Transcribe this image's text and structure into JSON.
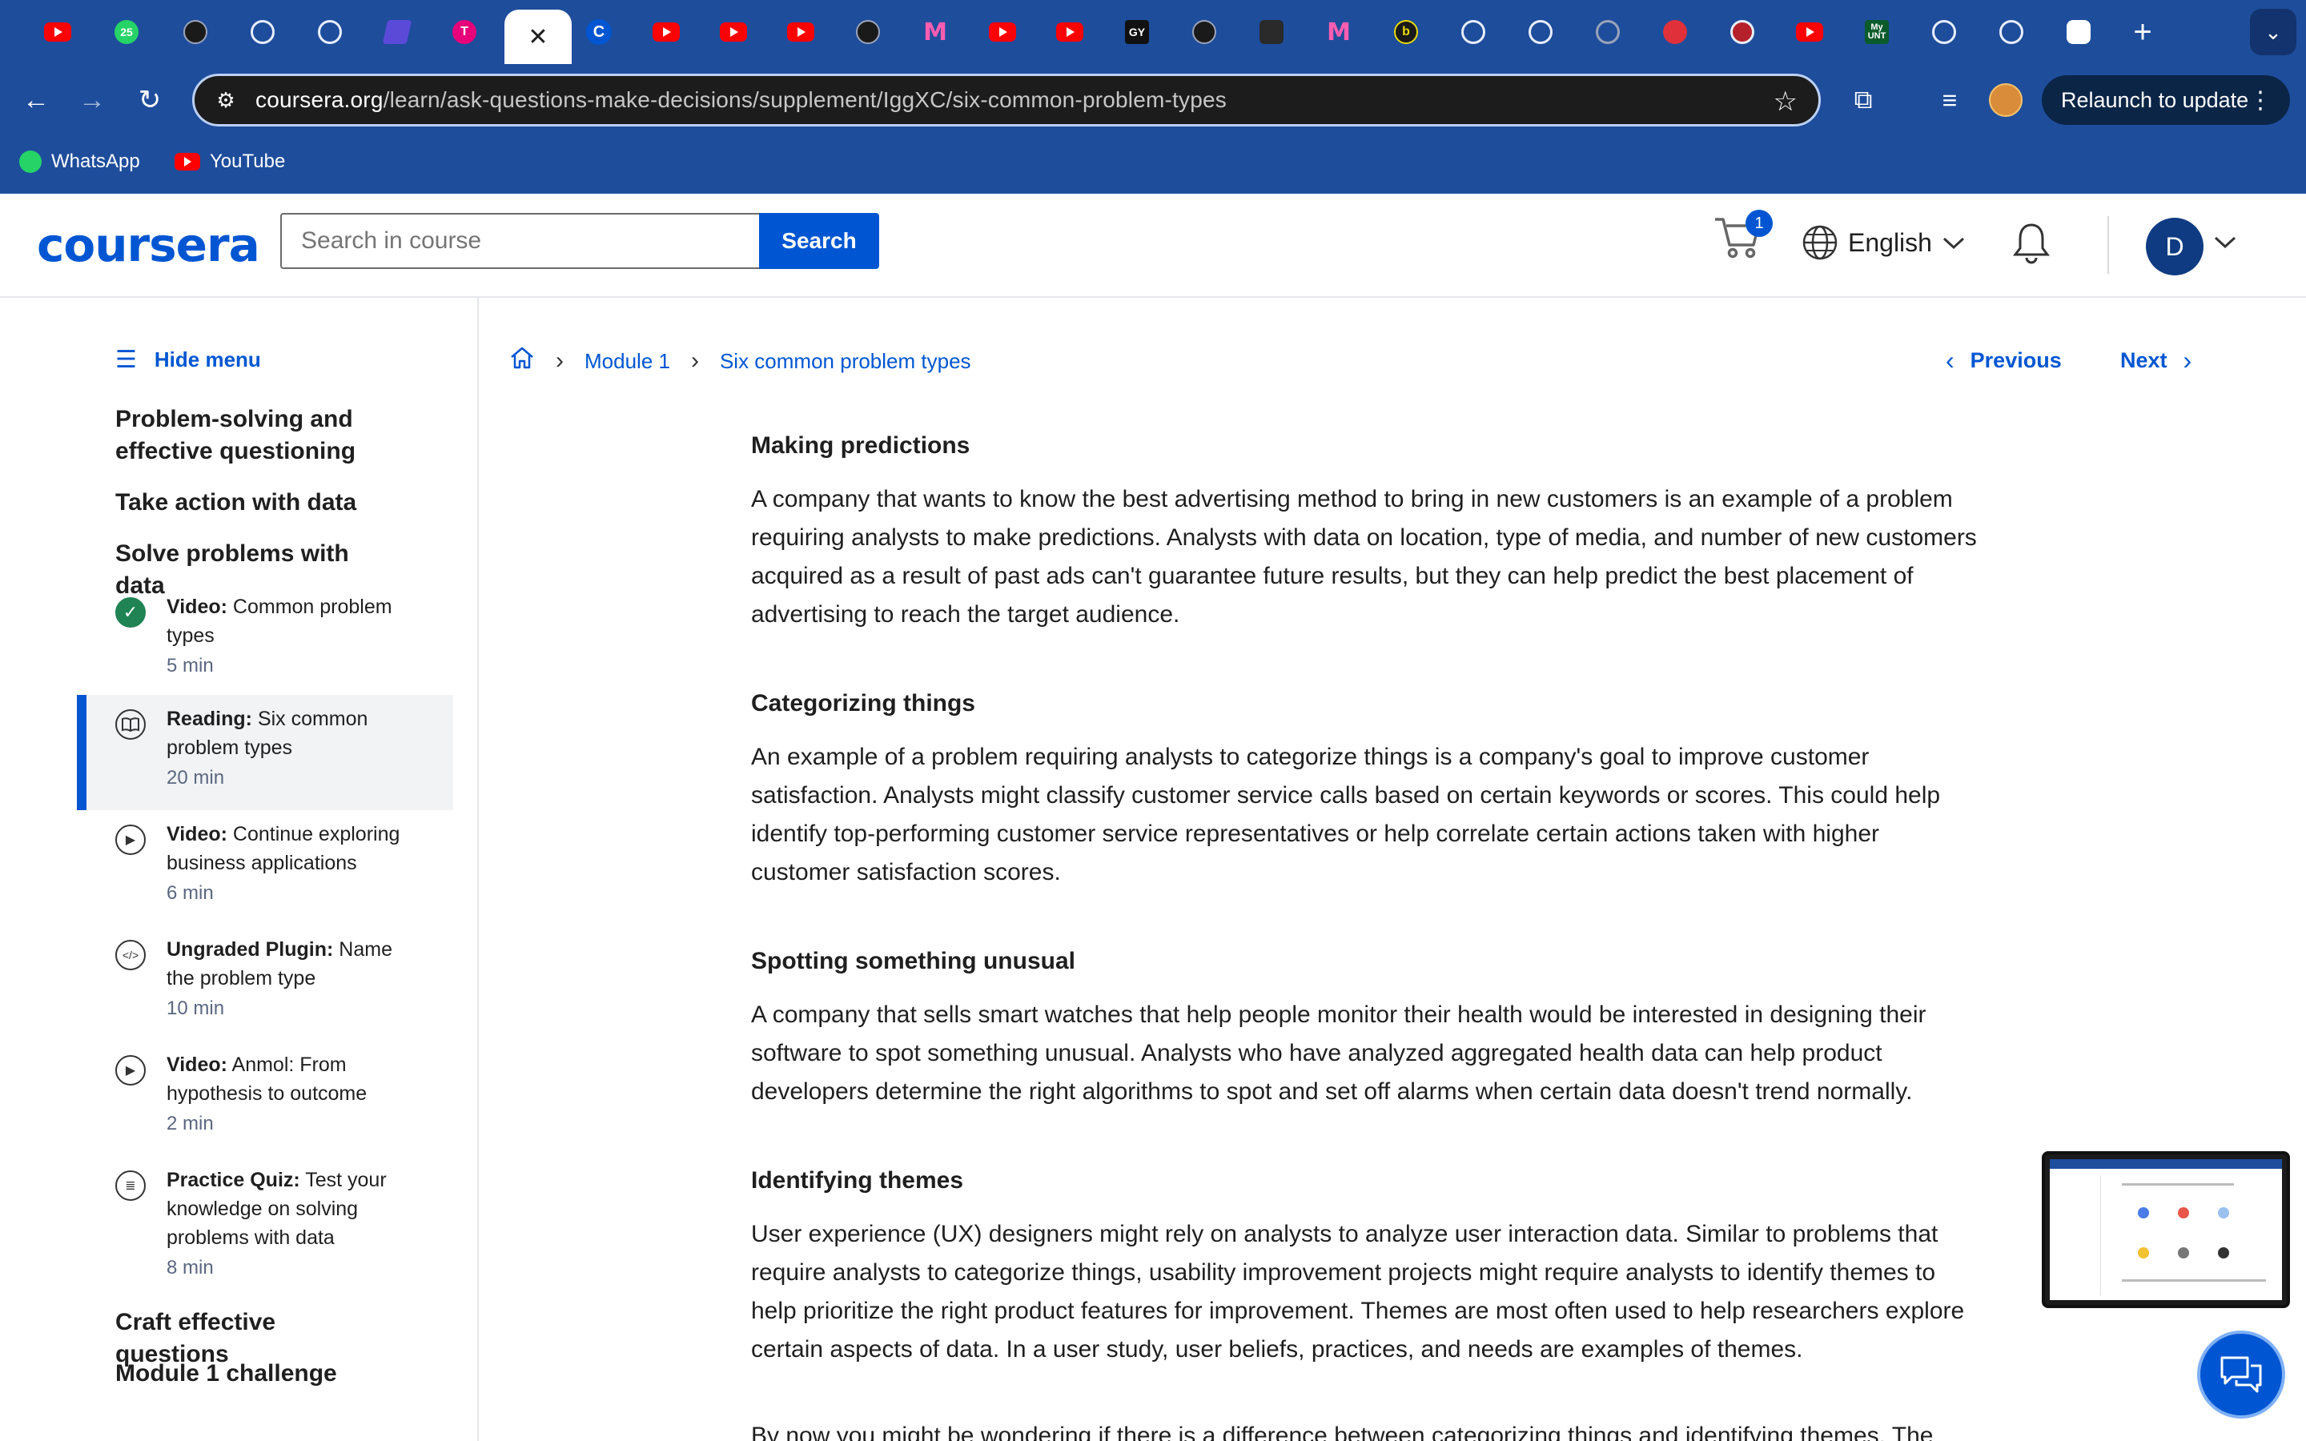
{
  "browser": {
    "tabs": [
      {
        "icon": "youtube-icon"
      },
      {
        "icon": "whatsapp-icon",
        "badge": "25"
      },
      {
        "icon": "openai-icon"
      },
      {
        "icon": "circle-icon"
      },
      {
        "icon": "github-icon"
      },
      {
        "icon": "app-icon"
      },
      {
        "icon": "t-icon"
      },
      {
        "icon": "close-icon",
        "active": true
      },
      {
        "icon": "coursera-icon"
      },
      {
        "icon": "youtube-icon"
      },
      {
        "icon": "youtube-icon"
      },
      {
        "icon": "youtube-icon"
      },
      {
        "icon": "compass-icon"
      },
      {
        "icon": "m-icon"
      },
      {
        "icon": "youtube-icon"
      },
      {
        "icon": "youtube-icon"
      },
      {
        "icon": "gy-icon"
      },
      {
        "icon": "openai-icon"
      },
      {
        "icon": "video-icon"
      },
      {
        "icon": "m-icon"
      },
      {
        "icon": "b-icon"
      },
      {
        "icon": "target-icon"
      },
      {
        "icon": "target-icon"
      },
      {
        "icon": "ring-icon"
      },
      {
        "icon": "red-ball-icon"
      },
      {
        "icon": "red-ball-icon"
      },
      {
        "icon": "youtube-icon"
      },
      {
        "icon": "unt-icon",
        "label": "My UNT"
      },
      {
        "icon": "coursera-icon"
      },
      {
        "icon": "coursera-icon"
      },
      {
        "icon": "openai-icon"
      }
    ],
    "url_domain": "coursera.org",
    "url_path": "/learn/ask-questions-make-decisions/supplement/IggXC/six-common-problem-types",
    "relaunch_label": "Relaunch to update",
    "bookmarks": [
      {
        "label": "WhatsApp",
        "icon": "whatsapp-icon"
      },
      {
        "label": "YouTube",
        "icon": "youtube-icon"
      }
    ]
  },
  "header": {
    "logo": "coursera",
    "search_placeholder": "Search in course",
    "search_button": "Search",
    "cart_count": "1",
    "language": "English",
    "avatar_initial": "D"
  },
  "sidebar": {
    "hide_menu": "Hide menu",
    "sections": [
      "Problem-solving and effective questioning",
      "Take action with data",
      "Solve problems with data"
    ],
    "items": [
      {
        "type": "Video:",
        "title": "Common problem types",
        "duration": "5 min",
        "icon": "check-icon",
        "done": true
      },
      {
        "type": "Reading:",
        "title": "Six common problem types",
        "duration": "20 min",
        "icon": "book-icon",
        "selected": true
      },
      {
        "type": "Video:",
        "title": "Continue exploring business applications",
        "duration": "6 min",
        "icon": "play-icon"
      },
      {
        "type": "Ungraded Plugin:",
        "title": "Name the problem type",
        "duration": "10 min",
        "icon": "code-icon"
      },
      {
        "type": "Video:",
        "title": "Anmol: From hypothesis to outcome",
        "duration": "2 min",
        "icon": "play-icon"
      },
      {
        "type": "Practice Quiz:",
        "title": "Test your knowledge on solving problems with data",
        "duration": "8 min",
        "icon": "quiz-icon"
      }
    ],
    "after_sections": [
      "Craft effective questions",
      "Module 1 challenge"
    ]
  },
  "breadcrumb": {
    "module": "Module 1",
    "page": "Six common problem types"
  },
  "nav": {
    "previous": "Previous",
    "next": "Next"
  },
  "article": {
    "sections": [
      {
        "heading": "Making predictions",
        "body": "A company that wants to know the best advertising method to bring in new customers is an example of a problem requiring analysts to make predictions. Analysts with data on location, type of media, and number of new customers acquired as a result of past ads can't guarantee future results, but they can help predict the best placement of advertising to reach the target audience."
      },
      {
        "heading": "Categorizing things",
        "body": "An example of a problem requiring analysts to categorize things is a company's goal to improve customer satisfaction. Analysts might classify customer service calls based on certain keywords or scores. This could help identify top-performing customer service representatives or help correlate certain actions taken with higher customer satisfaction scores."
      },
      {
        "heading": "Spotting something unusual",
        "body": "A company that sells smart watches that help people monitor their health would be interested in designing their software to spot something unusual. Analysts who have analyzed aggregated health data can help product developers determine the right algorithms to spot and set off alarms when certain data doesn't trend normally."
      },
      {
        "heading": "Identifying themes",
        "body": "User experience (UX) designers might rely on analysts to analyze user interaction data. Similar to problems that require analysts to categorize things, usability improvement projects might require analysts to identify themes to help prioritize the right product features for improvement. Themes are most often used to help researchers explore certain aspects of data. In a user study, user beliefs, practices, and needs are examples of themes."
      }
    ],
    "trailing_text": "By now you might be wondering if there is a difference between categorizing things and identifying themes. The"
  },
  "colors": {
    "browser_blue": "#1e4d9c",
    "coursera_blue": "#0056d2",
    "done_green": "#1f8354"
  }
}
